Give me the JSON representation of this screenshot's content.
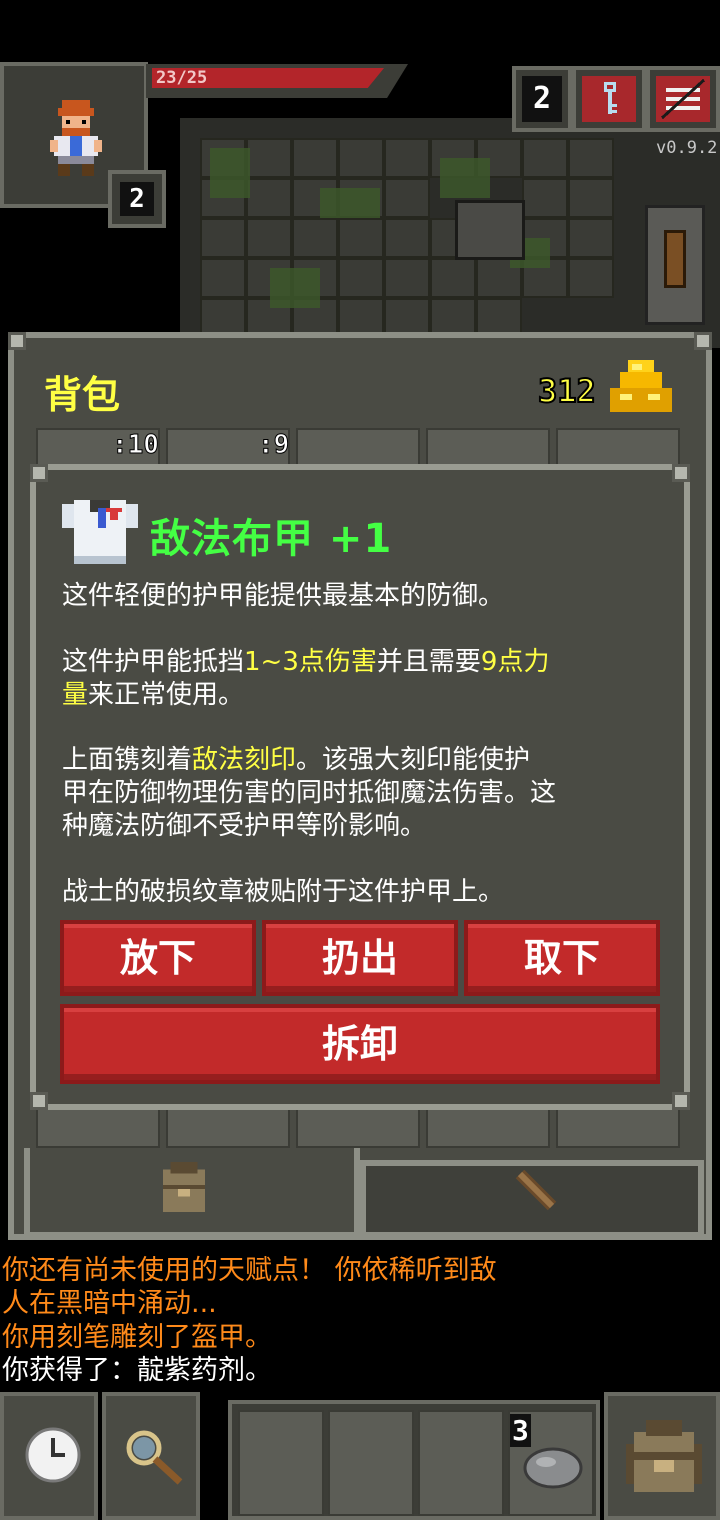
{
  "hud": {
    "hp": "23/25",
    "depth": "2",
    "danger_count": "2",
    "version": "v0.9.2",
    "colors": {
      "hp": "#b3252a",
      "panel": "#4a4b44",
      "accent_yellow": "#ffff44"
    },
    "icons": [
      "hero-portrait-icon",
      "key-icon",
      "menu-icon"
    ]
  },
  "inventory": {
    "title": "背包",
    "gold": "312",
    "slot_counts": [
      ":10",
      ":9"
    ]
  },
  "item": {
    "name": "敌法布甲 +1",
    "icon": "cloth-armor-icon",
    "desc1": "这件轻便的护甲能提供最基本的防御。",
    "desc2_a": "这件护甲能抵挡",
    "desc2_hl1": "1~3点伤害",
    "desc2_b": "并且需要",
    "desc2_hl2": "9点力",
    "desc2_hl3": "量",
    "desc2_c": "来正常使用。",
    "desc3_a": "上面镌刻着",
    "desc3_hl": "敌法刻印",
    "desc3_b": "。该强大刻印能使护",
    "desc3_c": "甲在防御物理伤害的同时抵御魔法伤害。这",
    "desc3_d": "种魔法防御不受护甲等阶影响。",
    "desc4": "战士的破损纹章被贴附于这件护甲上。",
    "buttons": {
      "drop": "放下",
      "throw": "扔出",
      "unequip": "取下",
      "detach": "拆卸"
    }
  },
  "log": {
    "line1": "你还有尚未使用的天赋点！  你依稀听到敌",
    "line2": "人在黑暗中涌动...",
    "line3": "你用刻笔雕刻了盔甲。",
    "line4": "你获得了：靛紫药剂。"
  },
  "toolbar": {
    "quickslot_count": "3",
    "icons": [
      "wait-clock-icon",
      "search-magnifier-icon",
      "stone-icon",
      "backpack-icon"
    ]
  }
}
